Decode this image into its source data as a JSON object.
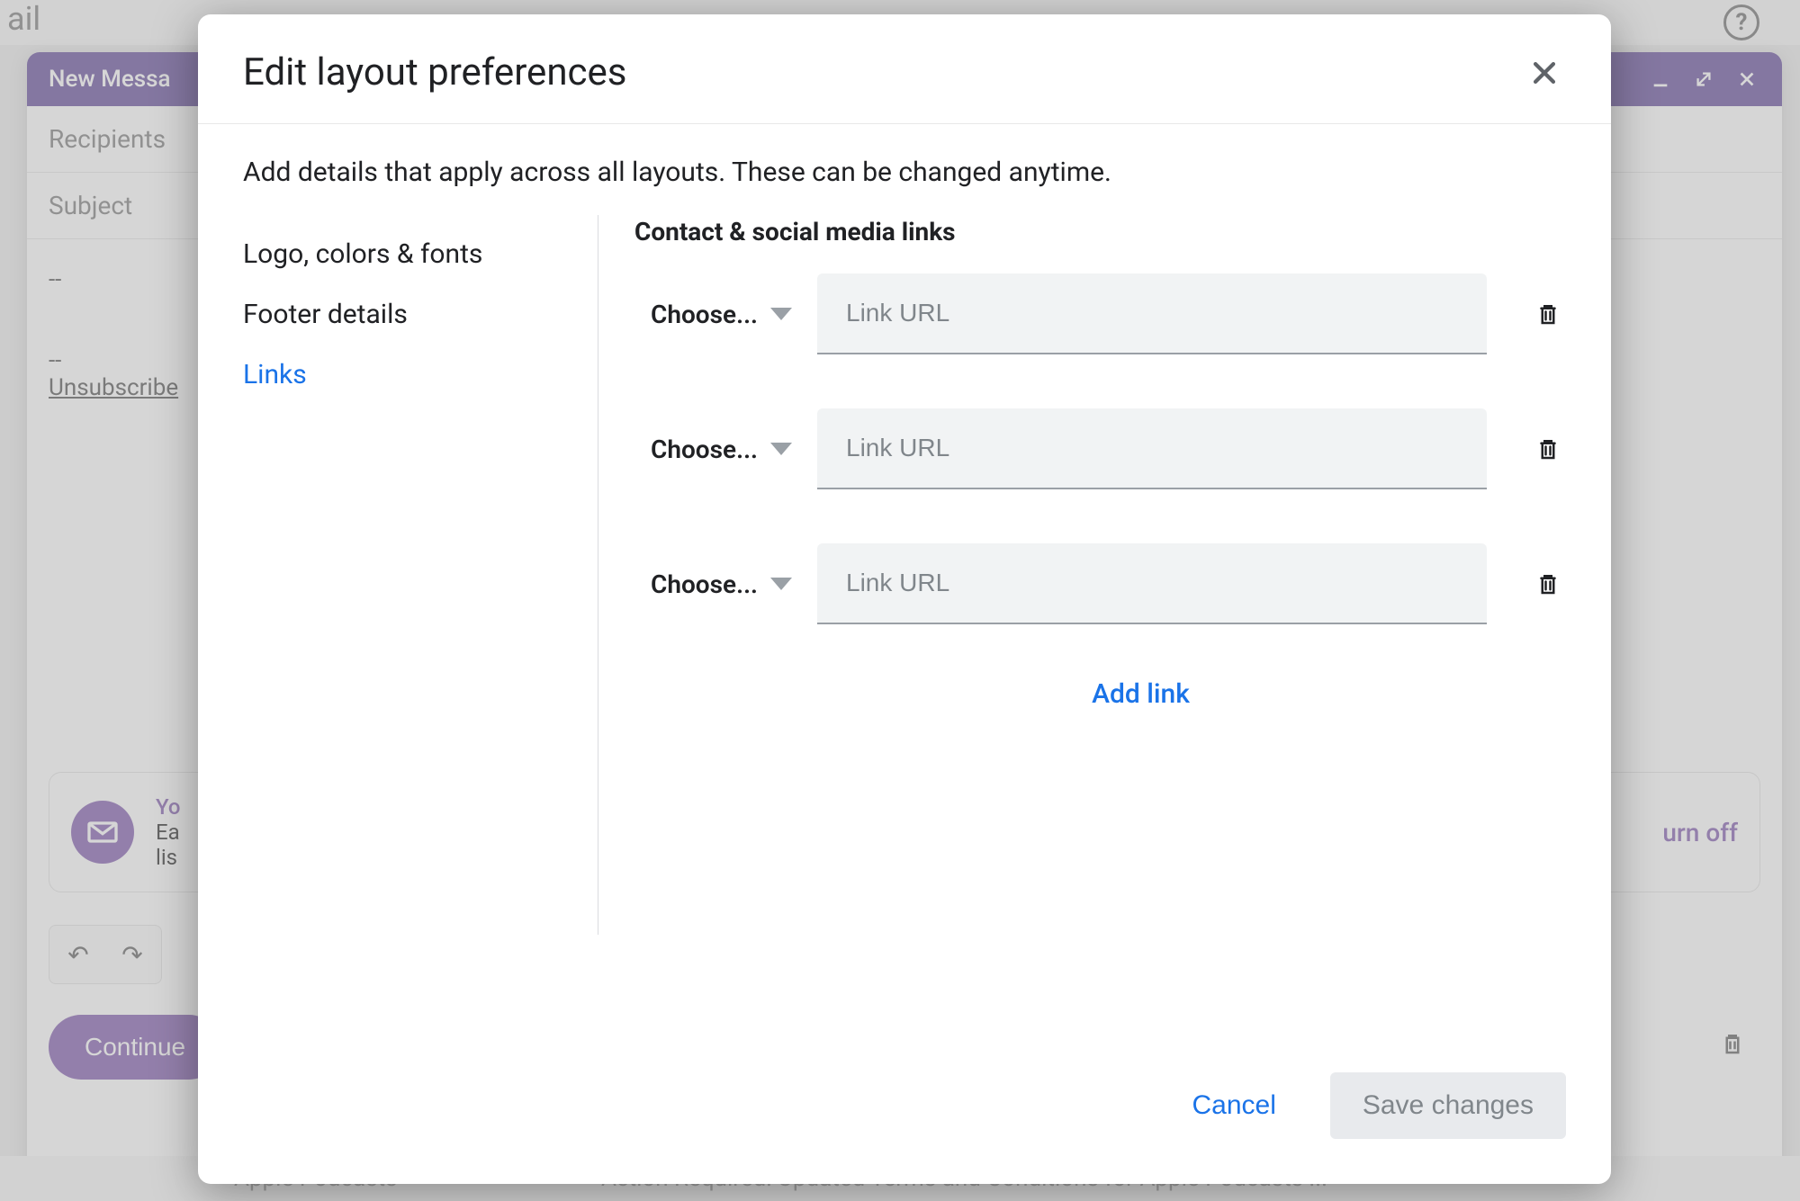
{
  "background": {
    "app_name": "ail",
    "help_icon": "?",
    "compose": {
      "title": "New Messa",
      "recipients_label": "Recipients",
      "subject_label": "Subject",
      "signature_dashes": "--",
      "unsubscribe_text": "Unsubscribe",
      "notice_heading": "Yo",
      "notice_line1": "Ea",
      "notice_line2": "lis",
      "turn_off": "urn off",
      "continue_label": "Continue",
      "bottom_snippet_left": "Apple Podcasts",
      "bottom_snippet_right": "Action Required: Updated Terms and Conditions for Apple Podcasts ..."
    }
  },
  "modal": {
    "title": "Edit layout preferences",
    "subtitle": "Add details that apply across all layouts. These can be changed anytime.",
    "sidebar": {
      "items": [
        {
          "label": "Logo, colors & fonts",
          "active": false
        },
        {
          "label": "Footer details",
          "active": false
        },
        {
          "label": "Links",
          "active": true
        }
      ]
    },
    "panel": {
      "title": "Contact & social media links",
      "choose_label": "Choose...",
      "url_placeholder": "Link URL",
      "rows": [
        {},
        {},
        {}
      ],
      "add_link_label": "Add link"
    },
    "footer": {
      "cancel": "Cancel",
      "save": "Save changes"
    }
  }
}
